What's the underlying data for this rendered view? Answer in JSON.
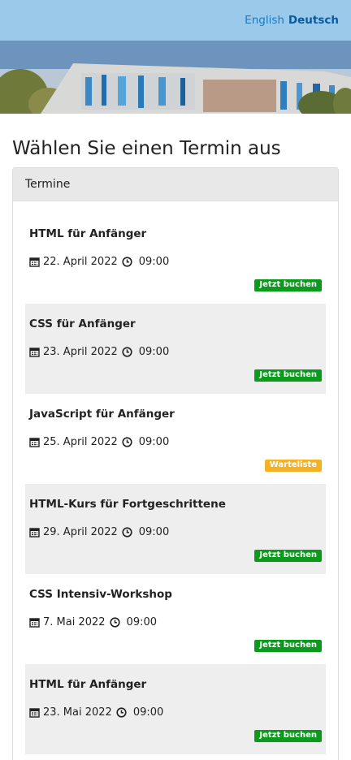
{
  "header": {
    "languages": [
      {
        "label": "English",
        "active": false
      },
      {
        "label": "Deutsch",
        "active": true
      }
    ]
  },
  "hero": {
    "image": "modern-glass-building-photo"
  },
  "page": {
    "title": "Wählen Sie einen Termin aus"
  },
  "panel": {
    "heading": "Termine"
  },
  "events": [
    {
      "title": "HTML für Anfänger",
      "date": "22. April 2022",
      "time": "09:00",
      "badge": "Jetzt buchen",
      "status": "book"
    },
    {
      "title": "CSS für Anfänger",
      "date": "23. April 2022",
      "time": "09:00",
      "badge": "Jetzt buchen",
      "status": "book"
    },
    {
      "title": "JavaScript für Anfänger",
      "date": "25. April 2022",
      "time": "09:00",
      "badge": "Warteliste",
      "status": "wait"
    },
    {
      "title": "HTML-Kurs für Fortgeschrittene",
      "date": "29. April 2022",
      "time": "09:00",
      "badge": "Jetzt buchen",
      "status": "book"
    },
    {
      "title": "CSS Intensiv-Workshop",
      "date": "7. Mai 2022",
      "time": "09:00",
      "badge": "Jetzt buchen",
      "status": "book"
    },
    {
      "title": "HTML für Anfänger",
      "date": "23. Mai 2022",
      "time": "09:00",
      "badge": "Jetzt buchen",
      "status": "book"
    }
  ],
  "colors": {
    "topbar": "#9ac9ea",
    "link": "#1a7ac0",
    "book_badge": "#0a9a1c",
    "wait_badge": "#f4b124",
    "alt_row": "#eeeeee"
  },
  "icons": {
    "date": "calendar-icon",
    "time": "clock-icon"
  }
}
